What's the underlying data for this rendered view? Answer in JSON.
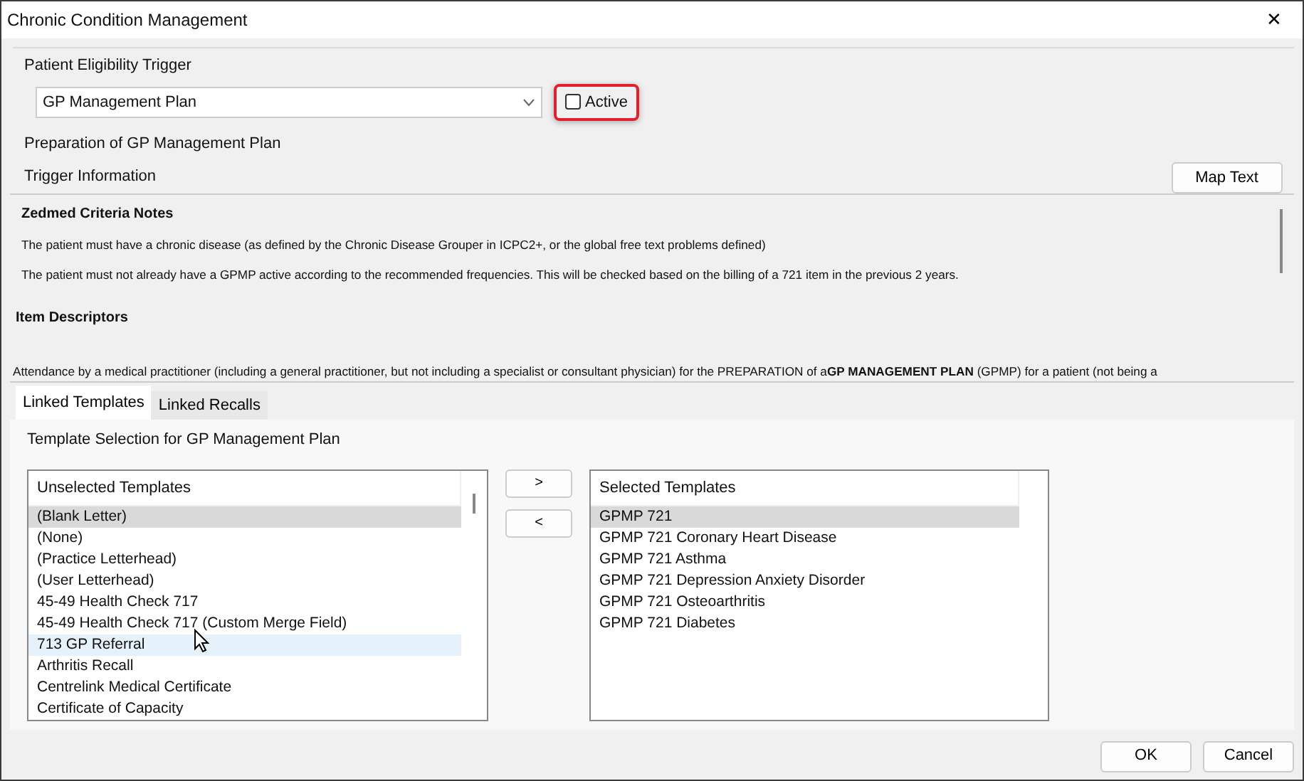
{
  "window": {
    "title": "Chronic Condition Management",
    "close": "✕"
  },
  "trigger": {
    "label": "Patient Eligibility Trigger",
    "value": "GP Management Plan",
    "active_label": "Active",
    "active": false,
    "highlighted": true
  },
  "description": "Preparation of GP Management Plan",
  "trigger_info": {
    "label": "Trigger Information",
    "map_button": "Map Text"
  },
  "notes": [
    {
      "kind": "heading",
      "text": "Zedmed Criteria Notes"
    },
    {
      "kind": "para",
      "text": "The patient must have a chronic disease (as defined by the Chronic Disease Grouper in ICPC2+, or the global free text problems defined)"
    },
    {
      "kind": "para",
      "text": "The patient must not already have a GPMP active according to the recommended frequencies. This will be checked based on the billing of a 721 item in the previous 2 years."
    },
    {
      "kind": "heading2",
      "text": "Item Descriptors"
    },
    {
      "kind": "wide",
      "text": "Attendance by a medical practitioner (including a general practitioner, but not including a specialist or consultant physician) for the PREPARATION of a**GP MANAGEMENT PLAN** (GPMP) for a patient (not being a"
    }
  ],
  "tabs": [
    {
      "label": "Linked Templates",
      "selected": true
    },
    {
      "label": "Linked Recalls",
      "selected": false
    }
  ],
  "template_heading": "Template Selection for GP Management Plan",
  "unselected": {
    "header": "Unselected Templates",
    "items": [
      {
        "label": "(Blank Letter)",
        "selected": true,
        "hovered": false
      },
      {
        "label": "(None)",
        "selected": false,
        "hovered": false
      },
      {
        "label": "(Practice Letterhead)",
        "selected": false,
        "hovered": false
      },
      {
        "label": "(User Letterhead)",
        "selected": false,
        "hovered": false
      },
      {
        "label": "45-49 Health Check 717",
        "selected": false,
        "hovered": false
      },
      {
        "label": "45-49 Health Check 717 (Custom Merge Field)",
        "selected": false,
        "hovered": false
      },
      {
        "label": "713 GP Referral",
        "selected": false,
        "hovered": true
      },
      {
        "label": "Arthritis Recall",
        "selected": false,
        "hovered": false
      },
      {
        "label": "Centrelink Medical Certificate",
        "selected": false,
        "hovered": false
      },
      {
        "label": "Certificate of Capacity",
        "selected": false,
        "hovered": false
      }
    ]
  },
  "move_buttons": [
    ">",
    "<"
  ],
  "selected": {
    "header": "Selected Templates",
    "items": [
      {
        "label": "GPMP 721",
        "selected": true
      },
      {
        "label": "GPMP 721 Coronary Heart Disease",
        "selected": false
      },
      {
        "label": "GPMP 721 Asthma",
        "selected": false
      },
      {
        "label": "GPMP 721 Depression Anxiety Disorder",
        "selected": false
      },
      {
        "label": "GPMP 721 Osteoarthritis",
        "selected": false
      },
      {
        "label": "GPMP 721 Diabetes",
        "selected": false
      }
    ]
  },
  "buttons": [
    "OK",
    "Cancel"
  ]
}
